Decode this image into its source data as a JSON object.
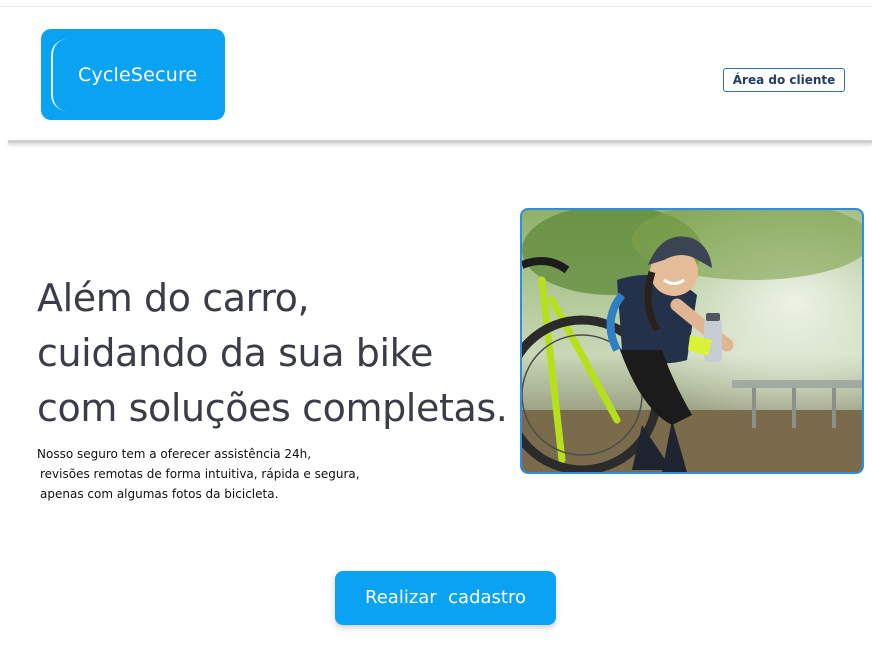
{
  "header": {
    "logo_text": "CycleSecure",
    "client_area_label": "Área do cliente"
  },
  "hero": {
    "title_lines": [
      "Além do carro,",
      "cuidando da sua bike",
      "com soluções completas."
    ],
    "description_lines": [
      "Nosso seguro tem a oferecer assistência 24h,",
      " revisões remotas de forma intuitiva, rápida e segura,",
      " apenas com algumas fotos da bicicleta."
    ],
    "photo_icon": "cyclist-photo"
  },
  "cta": {
    "label": "Realizar  cadastro"
  },
  "colors": {
    "brand_blue": "#0aa2f2",
    "outline_blue": "#2f6fb5",
    "title_text": "#3a3c48"
  }
}
